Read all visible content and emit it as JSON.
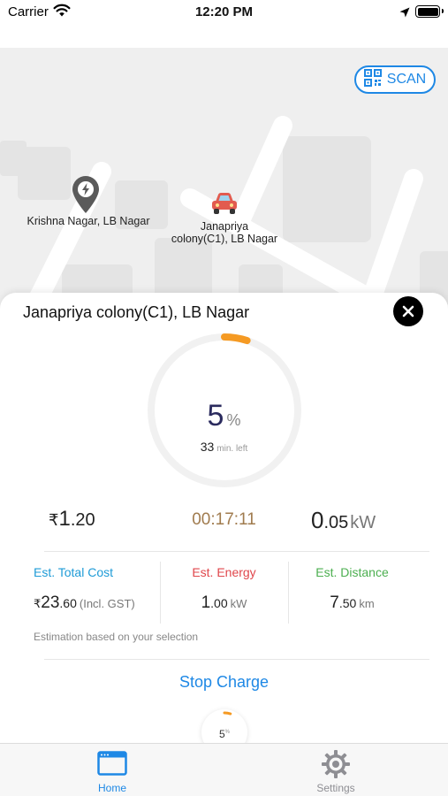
{
  "status_bar": {
    "carrier": "Carrier",
    "time": "12:20 PM"
  },
  "map": {
    "scan_label": "SCAN",
    "markers": [
      {
        "label": "Krishna Nagar, LB Nagar",
        "icon": "charging-station-pin-icon"
      },
      {
        "label_line1": "Janapriya",
        "label_line2": "colony(C1), LB Nagar",
        "icon": "car-icon"
      }
    ]
  },
  "station": {
    "title": "Janapriya colony(C1), LB Nagar",
    "progress": {
      "percent": "5",
      "percent_unit": "%",
      "progress_fraction": 0.05,
      "minutes_left": "33",
      "minutes_left_unit": "min. left"
    },
    "current_cost": {
      "symbol": "₹",
      "whole": "1",
      "decimal": ".20"
    },
    "elapsed": "00:17:11",
    "current_energy": {
      "whole": "0",
      "decimal": ".05",
      "unit": "kW"
    }
  },
  "estimates": {
    "total_cost": {
      "label": "Est. Total Cost",
      "symbol": "₹",
      "whole": "23",
      "decimal": ".60",
      "unit": "(Incl. GST)"
    },
    "energy": {
      "label": "Est. Energy",
      "whole": "1",
      "decimal": ".00",
      "unit": "kW"
    },
    "distance": {
      "label": "Est. Distance",
      "whole": "7",
      "decimal": ".50",
      "unit": "km"
    },
    "note": "Estimation based on your selection"
  },
  "stop_label": "Stop Charge",
  "mini_ring": {
    "value": "5",
    "unit": "%"
  },
  "tabs": [
    {
      "label": "Home",
      "icon": "home-window-icon",
      "active": true
    },
    {
      "label": "Settings",
      "icon": "gear-icon",
      "active": false
    }
  ],
  "colors": {
    "accent": "#1e88e5",
    "progress": "#f59a23",
    "cost_label": "#1e9bd7",
    "energy_label": "#e0464b",
    "distance_label": "#4caf50",
    "elapsed": "#a07b4e"
  }
}
